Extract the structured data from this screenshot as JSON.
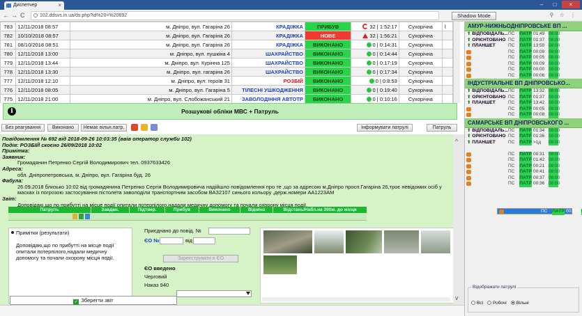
{
  "browser": {
    "tab_title": "Диспетчер",
    "url": "102.ddsvs.in.ua/ds.php?id%20=%20692",
    "shadow_mode": "Shadow Mode"
  },
  "incidents": [
    {
      "id": "783",
      "time": "12/11/2018 08:57",
      "address": "м. Дніпро, вул. Гагаріна 26",
      "type": "КРАДІЖКА",
      "type_color": "blue",
      "status": "ПРИБУВ",
      "status_color": "green",
      "marker": "spin",
      "num": "32 | 1:52:17",
      "dept": "Сухорічна",
      "attach": true
    },
    {
      "id": "782",
      "time": "10/10/2018 08:57",
      "address": "м. Дніпро, вул. Гагаріна 26",
      "type": "КРАДІЖКА",
      "type_color": "blue",
      "status": "НОВЕ",
      "status_color": "red",
      "marker": "red",
      "num": "32 | 1:56:21",
      "dept": "Сухорічна",
      "attach": false
    },
    {
      "id": "781",
      "time": "08/10/2018 08:51",
      "address": "м. Дніпро, вул. Гагаріна 26",
      "type": "КРАДІЖКА",
      "type_color": "blue",
      "status": "ВИКОНАНО",
      "status_color": "green",
      "marker": "green",
      "num": "0 | 0:14:31",
      "dept": "Сухорічна",
      "attach": false
    },
    {
      "id": "780",
      "time": "12/11/2018 13:00",
      "address": "м. Дніпро, вул. пушкіна 4",
      "type": "ШАХРАЙСТВО",
      "type_color": "blue",
      "status": "ВИКОНАНО",
      "status_color": "green",
      "marker": "green",
      "num": "0 | 0:14:44",
      "dept": "Сухорічна",
      "attach": false
    },
    {
      "id": "779",
      "time": "12/11/2018 13:44",
      "address": "м. Дніпро, вул. Курінна 125",
      "type": "ШАХРАЙСТВО",
      "type_color": "blue",
      "status": "ВИКОНАНО",
      "status_color": "green",
      "marker": "green",
      "num": "0 | 0:17:19",
      "dept": "Сухорічна",
      "attach": false
    },
    {
      "id": "778",
      "time": "12/11/2018 13:30",
      "address": "м. Дніпро, вул. гагаріна 26",
      "type": "ШАХРАЙСТВО",
      "type_color": "blue",
      "status": "ВИКОНАНО",
      "status_color": "green",
      "marker": "green",
      "num": "0 | 0:17:34",
      "dept": "Сухорічна",
      "attach": false
    },
    {
      "id": "777",
      "time": "12/11/2018 12:10",
      "address": "м. Дніпро, вул. героїв 31",
      "type": "РОЗБІЙ",
      "type_color": "red",
      "status": "ВИКОНАНО",
      "status_color": "green",
      "marker": "green",
      "num": "0 | 0:8:53",
      "dept": "Сухорічна",
      "attach": false
    },
    {
      "id": "776",
      "time": "12/11/2018 08:05",
      "address": "м. Дніпро, вул. Гагаріна 5",
      "type": "ТІЛЕСНІ УШКОДЖЕННЯ",
      "type_color": "blue",
      "status": "ВИКОНАНО",
      "status_color": "green",
      "marker": "green",
      "num": "0 | 0:19:40",
      "dept": "Сухорічна",
      "attach": false
    },
    {
      "id": "775",
      "time": "12/11/2018 21:00",
      "address": "м. Дніпро, вул. Слобожанський 21",
      "type": "ЗАВОЛОДІННЯ АВТОТР",
      "type_color": "blue",
      "status": "ВИКОНАНО",
      "status_color": "green",
      "marker": "green",
      "num": "0 | 0:10:16",
      "dept": "Сухорічна",
      "attach": false
    }
  ],
  "banner": {
    "text": "Розшукові обліки МВС + Патруль",
    "icon": "info-icon"
  },
  "toolbar": {
    "no_reaction": "Без реагування",
    "done": "Виконано",
    "no_patrol": "Немає вільн.патр.",
    "inform_patrols": "Інформувати патрулі",
    "patrol": "Патруль"
  },
  "detail": {
    "line1": "Повідомлення № 692 від 2018-09-26 10:03:35 (ввів оператор служби 102)",
    "line2": "Подія: РОЗБІЙ скоєно 26/09/2018 10:02",
    "note_label": "Примітка:",
    "applicant_label": "Заявник:",
    "applicant": "Громадянин Петренко Сергій Володимирович тел. 0937633426",
    "address_label": "Адреса:",
    "address": "обл. Дніпропетровська, м. Дніпро, вул. Гагаріна буд. 26",
    "plot_label": "Фабула:",
    "plot": "26.09.2018 близько 10:02 від громадянина Петренко Сергія Володимировича надійшло повідомлення про те ,що за адресою м.Дніпро просп.Гагаріна 26,троє невідомих осіб у масках із погрозою застосування пістолета заволоділи транспортним засобом ВАЗ2107 синього кольору ,держ.номери АА1223АМ",
    "report_label": "Звіт:",
    "report": "Доповідаю,що по прибутті на місце події опитали потерпілого,надали медичну допомогу та почали охорону місця події."
  },
  "patrol_table": {
    "headers": [
      "Патруль",
      "Завдан.",
      "Підтвер.",
      "Прибув",
      "Виконано",
      "Відміна",
      "Відстань/Набл.на 200м. до місця"
    ]
  },
  "notes": {
    "title": "Примітки (результати)",
    "text": "Доповідаю,що по прибутті на місце події опитали потерпілого,надали медичну допомогу та почали охорону місця події.",
    "save": "Зберегти звіт"
  },
  "assign": {
    "attached_label": "Приєднано до повід. №",
    "eo_label": "ЄО №",
    "from_label": "від",
    "register": "Зареєструвати в ЄО",
    "eo_entered": "ЄО введено",
    "duty": "Черговий",
    "order": "Наказ 940"
  },
  "right_panel": {
    "departments": [
      {
        "name": "АМУР-НИЖНЬОДНІПРОВСЬКЕ ВП ...",
        "units": [
          {
            "kind": "name",
            "name": "ВІДПОВІДАЛЬ...",
            "pc": "ПС",
            "st": "ПАТР",
            "tm": "01:49",
            "tm2": "08:00"
          },
          {
            "kind": "name",
            "name": "ОРІЄНТОВАНО",
            "pc": "ПС",
            "st": "ПАТР",
            "tm": "01:37",
            "tm2": "08:00"
          },
          {
            "kind": "name",
            "name": "ПЛАНШЕТ",
            "pc": "ПС",
            "st": "ПАТР",
            "tm": "13:50",
            "tm2": "08:00"
          },
          {
            "kind": "car",
            "name": "",
            "pc": "ПС",
            "st": "ПАТР",
            "tm": "00:09",
            "tm2": "08:00"
          },
          {
            "kind": "car",
            "name": "",
            "pc": "ПС",
            "st": "ПАТР",
            "tm": "00:05",
            "tm2": "08:00"
          },
          {
            "kind": "car",
            "name": "",
            "pc": "ПС",
            "st": "ПАТР",
            "tm": "00:09",
            "tm2": "08:00"
          },
          {
            "kind": "car",
            "name": "",
            "pc": "ПС",
            "st": "ПАТР",
            "tm": "00:00",
            "tm2": "08:00"
          },
          {
            "kind": "car",
            "name": "",
            "pc": "ПС",
            "st": "ПАТР",
            "tm": "00:06",
            "tm2": "08:00"
          }
        ]
      },
      {
        "name": "ІНДУСТРІАЛЬНЕ ВП ДНІПРОВСЬКО...",
        "units": [
          {
            "kind": "name",
            "name": "ВІДПОВІДАЛЬ...",
            "pc": "ПС",
            "st": "ПАТР",
            "tm": "13:32",
            "tm2": "08:00"
          },
          {
            "kind": "name",
            "name": "ОРІЄНТОВАНО",
            "pc": "ПС",
            "st": "ПАТР",
            "tm": "01:37",
            "tm2": "08:00"
          },
          {
            "kind": "name",
            "name": "ПЛАНШЕТ",
            "pc": "ПС",
            "st": "ПАТР",
            "tm": "13:42",
            "tm2": "08:00"
          },
          {
            "kind": "car",
            "name": "",
            "pc": "ПС",
            "st": "ПАТР",
            "tm": "00:05",
            "tm2": "08:00"
          },
          {
            "kind": "car",
            "name": "",
            "pc": "ПС",
            "st": "ПАТР",
            "tm": "00:08",
            "tm2": "08:00"
          }
        ]
      },
      {
        "name": "САМАРСЬКЕ ВП ДНІПРОВСЬКОГО ...",
        "units": [
          {
            "kind": "name",
            "name": "ВІДПОВІДАЛЬ...",
            "pc": "ПС",
            "st": "ПАТР",
            "tm": "01:34",
            "tm2": "08:00"
          },
          {
            "kind": "name",
            "name": "ОРІЄНТОВАНО",
            "pc": "ПС",
            "st": "ПАТР",
            "tm": "01:36",
            "tm2": "08:00"
          },
          {
            "kind": "name",
            "name": "ПЛАНШЕТ",
            "pc": "ПС",
            "st": "ПАТР",
            "tm": ">1д",
            "tm2": "08:00"
          },
          {
            "kind": "car",
            "name": "",
            "pc": "ПС",
            "st": "ПАТР",
            "tm": "00:13",
            "tm2": "08:00",
            "selected": true
          },
          {
            "kind": "car",
            "name": "",
            "pc": "ПС",
            "st": "ПАТР",
            "tm": "00:31",
            "tm2": "08:00"
          },
          {
            "kind": "car",
            "name": "",
            "pc": "ПС",
            "st": "ПАТР",
            "tm": "01:42",
            "tm2": "08:00"
          },
          {
            "kind": "car",
            "name": "",
            "pc": "ПС",
            "st": "ПАТР",
            "tm": "00:21",
            "tm2": "08:00"
          },
          {
            "kind": "car",
            "name": "",
            "pc": "ПС",
            "st": "ПАТР",
            "tm": "00:41",
            "tm2": "08:00"
          },
          {
            "kind": "car",
            "name": "",
            "pc": "ПС",
            "st": "ПАТР",
            "tm": "00:37",
            "tm2": "08:00"
          },
          {
            "kind": "car",
            "name": "",
            "pc": "ПС",
            "st": "ПАТР",
            "tm": "00:36",
            "tm2": "08:00"
          }
        ]
      }
    ],
    "filter_title": "Відображати патрулі",
    "filter_options": [
      "Всі",
      "Робочі",
      "Вільні"
    ],
    "filter_selected": 2
  },
  "colors": {
    "accent_green": "#8ed27c",
    "status_green": "#29d34a",
    "status_red": "#f03a2e",
    "type_blue": "#1a3fc8"
  }
}
